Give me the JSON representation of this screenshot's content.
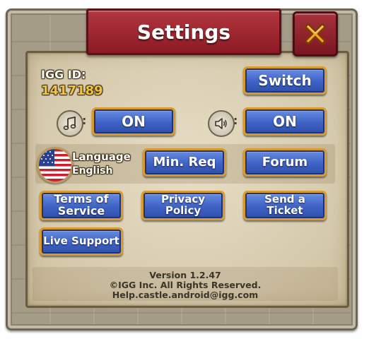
{
  "title": "Settings",
  "account": {
    "label": "IGG ID:",
    "id": "1417189",
    "switch_label": "Switch"
  },
  "music": {
    "icon": "music-note-icon",
    "separator": ":",
    "state": "ON"
  },
  "sound": {
    "icon": "speaker-icon",
    "separator": ":",
    "state": "ON"
  },
  "language": {
    "label": "Language",
    "value": "English",
    "flag_icon": "us-flag-icon"
  },
  "buttons": {
    "min_req": "Min. Req",
    "forum": "Forum",
    "terms": "Terms of Service",
    "privacy": "Privacy Policy",
    "ticket": "Send a Ticket",
    "live_support": "Live Support"
  },
  "footer": {
    "version": "Version 1.2.47",
    "copyright": "©IGG Inc. All Rights Reserved.",
    "email": "Help.castle.android@igg.com"
  },
  "colors": {
    "title_banner": "#9b232d",
    "button_blue": "#3e62c6",
    "button_border": "#d99a2b",
    "id_gold": "#f2c341"
  }
}
